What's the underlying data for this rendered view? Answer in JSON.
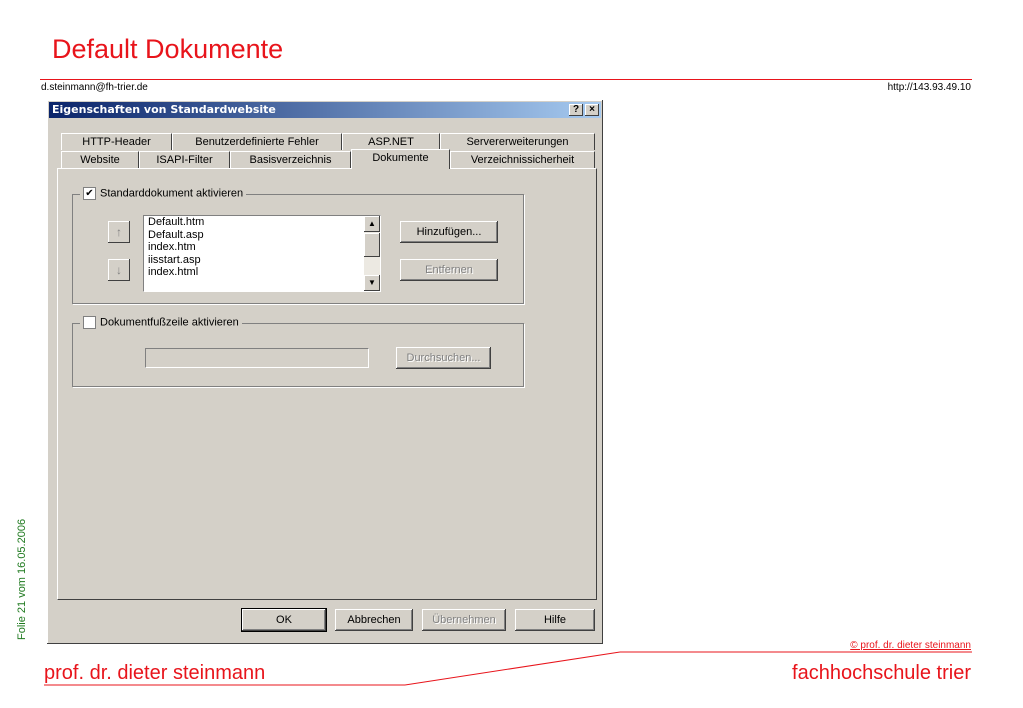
{
  "slide": {
    "title": "Default Dokumente",
    "email": "d.steinmann@fh-trier.de",
    "url": "http://143.93.49.10",
    "side_label": "Folie 21 vom 16.05.2006",
    "copyright": "© prof. dr. dieter steinmann",
    "footer_left": "prof. dr. dieter steinmann",
    "footer_right": "fachhochschule trier"
  },
  "dialog": {
    "title": "Eigenschaften von Standardwebsite",
    "help_btn": "?",
    "close_btn": "×",
    "tabs_row1": [
      "HTTP-Header",
      "Benutzerdefinierte Fehler",
      "ASP.NET",
      "Servererweiterungen"
    ],
    "tabs_row2": [
      "Website",
      "ISAPI-Filter",
      "Basisverzeichnis",
      "Dokumente",
      "Verzeichnissicherheit"
    ],
    "active_tab": "Dokumente",
    "default_docs": {
      "checkbox_label": "Standarddokument aktivieren",
      "checked": true,
      "items": [
        "Default.htm",
        "Default.asp",
        "index.htm",
        "iisstart.asp",
        "index.html"
      ],
      "add_button": "Hinzufügen...",
      "remove_button": "Entfernen",
      "up_icon": "arrow-up-icon",
      "down_icon": "arrow-down-icon"
    },
    "footer_doc": {
      "checkbox_label": "Dokumentfußzeile aktivieren",
      "checked": false,
      "path_value": "",
      "browse_button": "Durchsuchen..."
    },
    "buttons": {
      "ok": "OK",
      "cancel": "Abbrechen",
      "apply": "Übernehmen",
      "help": "Hilfe"
    }
  },
  "colors": {
    "accent": "#e8141b",
    "side_label": "#1f7a1f",
    "titlebar": "#0a246a",
    "dialog_bg": "#d4d0c8"
  }
}
